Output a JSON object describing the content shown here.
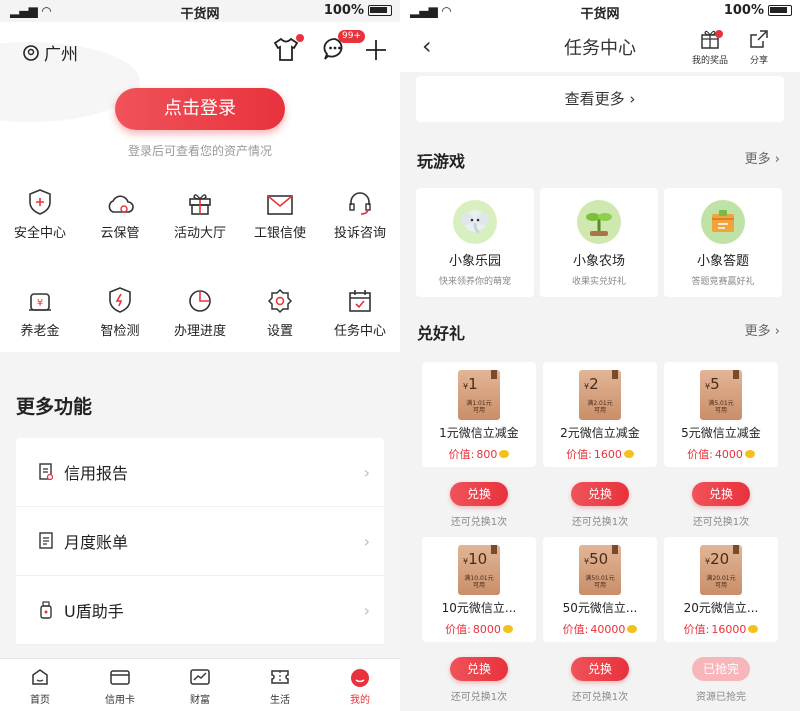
{
  "status": {
    "carrier": "..ıl ≋",
    "time": "干货网",
    "battery": "100%"
  },
  "left": {
    "location": "广州",
    "msg_badge": "99+",
    "login_button": "点击登录",
    "login_tip": "登录后可查看您的资产情况",
    "grid_row1": [
      {
        "label": "安全中心",
        "icon": "shield-icon"
      },
      {
        "label": "云保管",
        "icon": "cloud-icon"
      },
      {
        "label": "活动大厅",
        "icon": "gift-icon"
      },
      {
        "label": "工银信使",
        "icon": "mail-icon"
      },
      {
        "label": "投诉咨询",
        "icon": "headset-icon"
      }
    ],
    "grid_row2": [
      {
        "label": "养老金",
        "icon": "pension-icon"
      },
      {
        "label": "智检测",
        "icon": "lightning-shield-icon"
      },
      {
        "label": "办理进度",
        "icon": "pie-icon"
      },
      {
        "label": "设置",
        "icon": "gear-icon"
      },
      {
        "label": "任务中心",
        "icon": "calendar-check-icon"
      }
    ],
    "more_title": "更多功能",
    "functions": [
      {
        "label": "信用报告",
        "icon": "report-icon"
      },
      {
        "label": "月度账单",
        "icon": "bill-icon"
      },
      {
        "label": "U盾助手",
        "icon": "ushield-icon"
      }
    ],
    "tabs": [
      {
        "label": "首页",
        "icon": "home-icon"
      },
      {
        "label": "信用卡",
        "icon": "card-icon"
      },
      {
        "label": "财富",
        "icon": "chart-icon"
      },
      {
        "label": "生活",
        "icon": "ticket-icon"
      },
      {
        "label": "我的",
        "icon": "user-icon"
      }
    ]
  },
  "right": {
    "title": "任务中心",
    "my_prizes": "我的奖品",
    "share": "分享",
    "view_more": "查看更多",
    "games_title": "玩游戏",
    "more": "更多",
    "games": [
      {
        "name": "小象乐园",
        "desc": "快来领养你的萌宠"
      },
      {
        "name": "小象农场",
        "desc": "收果实兑好礼"
      },
      {
        "name": "小象答题",
        "desc": "答题竞赛赢好礼"
      }
    ],
    "gifts_title": "兑好礼",
    "gifts": [
      {
        "amount": "1",
        "cond": "满1.01元",
        "use": "可用",
        "name": "1元微信立减金",
        "value_label": "价值:",
        "value": "800",
        "btn": "兑换",
        "note": "还可兑换1次"
      },
      {
        "amount": "2",
        "cond": "满2.01元",
        "use": "可用",
        "name": "2元微信立减金",
        "value_label": "价值:",
        "value": "1600",
        "btn": "兑换",
        "note": "还可兑换1次"
      },
      {
        "amount": "5",
        "cond": "满5.01元",
        "use": "可用",
        "name": "5元微信立减金",
        "value_label": "价值:",
        "value": "4000",
        "btn": "兑换",
        "note": "还可兑换1次"
      },
      {
        "amount": "10",
        "cond": "满10.01元",
        "use": "可用",
        "name": "10元微信立...",
        "value_label": "价值:",
        "value": "8000",
        "btn": "兑换",
        "note": "还可兑换1次"
      },
      {
        "amount": "50",
        "cond": "满50.01元",
        "use": "可用",
        "name": "50元微信立...",
        "value_label": "价值:",
        "value": "40000",
        "btn": "兑换",
        "note": "还可兑换1次"
      },
      {
        "amount": "20",
        "cond": "满20.01元",
        "use": "可用",
        "name": "20元微信立...",
        "value_label": "价值:",
        "value": "16000",
        "btn": "已抢完",
        "note": "资源已抢完"
      }
    ],
    "currency": "¥"
  }
}
